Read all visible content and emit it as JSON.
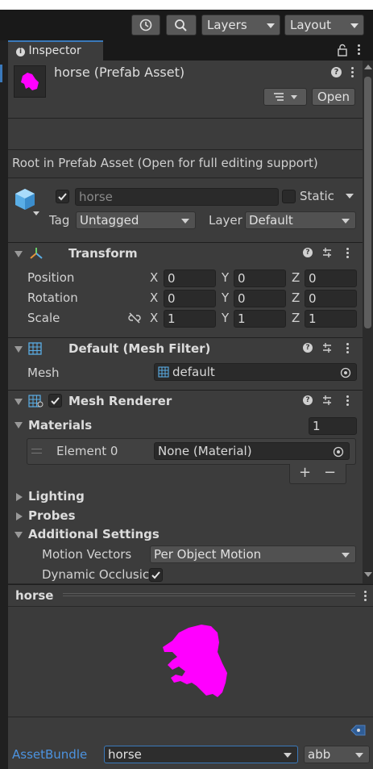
{
  "toolbar": {
    "layers_label": "Layers",
    "layout_label": "Layout"
  },
  "tab": {
    "label": "Inspector"
  },
  "asset": {
    "title": "horse (Prefab Asset)",
    "open_label": "Open",
    "root_message": "Root in Prefab Asset (Open for full editing support)"
  },
  "gameobject": {
    "name": "horse",
    "static_label": "Static",
    "tag_label": "Tag",
    "tag_value": "Untagged",
    "layer_label": "Layer",
    "layer_value": "Default"
  },
  "transform": {
    "title": "Transform",
    "rows": [
      {
        "label": "Position",
        "x": "0",
        "y": "0",
        "z": "0"
      },
      {
        "label": "Rotation",
        "x": "0",
        "y": "0",
        "z": "0"
      },
      {
        "label": "Scale",
        "x": "1",
        "y": "1",
        "z": "1"
      }
    ],
    "axis": {
      "x": "X",
      "y": "Y",
      "z": "Z"
    }
  },
  "mesh_filter": {
    "title": "Default (Mesh Filter)",
    "mesh_label": "Mesh",
    "mesh_value": "default"
  },
  "mesh_renderer": {
    "title": "Mesh Renderer",
    "materials_label": "Materials",
    "materials_count": "1",
    "element_label": "Element 0",
    "element_value": "None (Material)",
    "add_label": "+",
    "remove_label": "−",
    "lighting_label": "Lighting",
    "probes_label": "Probes",
    "additional_label": "Additional Settings",
    "motion_label": "Motion Vectors",
    "motion_value": "Per Object Motion",
    "occlusion_label": "Dynamic Occlusic"
  },
  "preview": {
    "title": "horse"
  },
  "assetbundle": {
    "label": "AssetBundle",
    "name_value": "horse",
    "variant_value": "abb"
  },
  "colors": {
    "accent": "#3a79bb",
    "prefab_magenta": "#ff00ff",
    "link_blue": "#4c93e0"
  }
}
